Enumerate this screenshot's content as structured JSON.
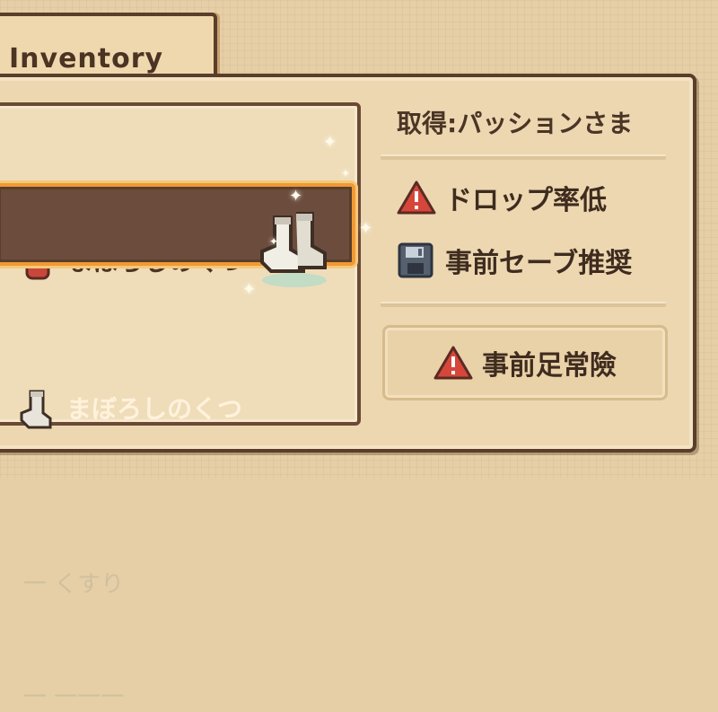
{
  "tab": {
    "title": "Inventory"
  },
  "list": {
    "items": [
      {
        "label": "まぼろしのくつ",
        "icon": "potion-icon",
        "selected": false
      },
      {
        "label": "まぼろしのくつ",
        "icon": "sock-icon",
        "selected": true
      },
      {
        "label": "一 くすり",
        "icon": "",
        "selected": false,
        "faded": true
      },
      {
        "label": "一 一一一",
        "icon": "",
        "selected": false,
        "faded": true
      }
    ]
  },
  "info": {
    "acquire": "取得:パッションさま",
    "drop_rate": "ドロップ率低",
    "save_recommend": "事前セーブ推奨",
    "button_label": "事前足常險"
  },
  "colors": {
    "selection_border": "#f09a35",
    "selection_fill": "#6c4d3d",
    "warning_red": "#d6463a",
    "panel_border": "#5a3e2b"
  }
}
